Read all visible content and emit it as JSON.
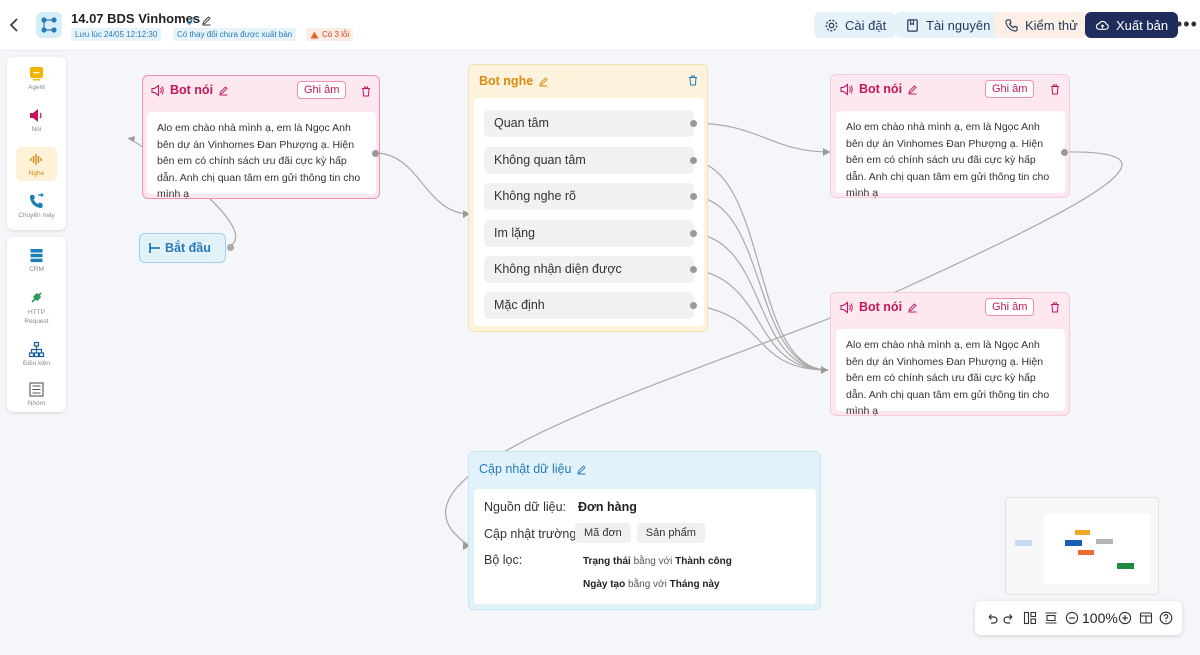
{
  "header": {
    "title": "14.07 BDS Vinhomes",
    "saved_at": "Lưu lúc 24/05 12:12:30",
    "unpublished_notice": "Có thay đổi chưa được xuất bản",
    "error_badge": "Có 3 lỗi",
    "buttons": {
      "settings": "Cài đặt",
      "resources": "Tài nguyên",
      "test": "Kiểm thử",
      "publish": "Xuất bản"
    }
  },
  "palette": {
    "group1": [
      {
        "label": "Agent",
        "icon": "agent-icon"
      },
      {
        "label": "Nói",
        "icon": "speaker-icon"
      },
      {
        "label": "Nghe",
        "icon": "soundwave-icon"
      },
      {
        "label": "Chuyển máy",
        "icon": "phone-transfer-icon"
      }
    ],
    "group2": [
      {
        "label": "CRM",
        "icon": "database-icon"
      },
      {
        "label": "HTTP Request",
        "icon": "plug-icon"
      },
      {
        "label": "Điều kiện",
        "icon": "hierarchy-icon"
      },
      {
        "label": "Nhóm",
        "icon": "group-icon"
      }
    ]
  },
  "nodes": {
    "start": {
      "label": "Bắt đầu"
    },
    "bot_speak_1": {
      "title": "Bot nói",
      "record": "Ghi âm",
      "message": "Alo em chào nhà mình ạ, em là Ngọc Anh bên dự án Vinhomes Đan Phượng ạ. Hiện bên em có chính sách ưu đãi cực kỳ hấp dẫn. Anh chị quan tâm em gửi thông tin cho mình ạ"
    },
    "bot_listen": {
      "title": "Bot nghe",
      "options": [
        "Quan tâm",
        "Không quan tâm",
        "Không nghe rõ",
        "Im lặng",
        "Không nhận diện được",
        "Mặc định"
      ]
    },
    "bot_speak_2": {
      "title": "Bot nói",
      "record": "Ghi âm",
      "message": "Alo em chào nhà mình ạ, em là Ngọc Anh bên dự án Vinhomes Đan Phượng ạ. Hiện bên em có chính sách ưu đãi cực kỳ hấp dẫn. Anh chị quan tâm em gửi thông tin cho mình ạ"
    },
    "bot_speak_3": {
      "title": "Bot nói",
      "record": "Ghi âm",
      "message": "Alo em chào nhà mình ạ, em là Ngọc Anh bên dự án Vinhomes Đan Phượng ạ. Hiện bên em có chính sách ưu đãi cực kỳ hấp dẫn. Anh chị quan tâm em gửi thông tin cho mình ạ"
    },
    "update_data": {
      "title": "Cập nhật dữ liệu",
      "source_label": "Nguồn dữ liệu:",
      "source_value": "Đơn hàng",
      "fields_label": "Cập nhật trường:",
      "fields": [
        "Mã đơn",
        "Sản phẩm"
      ],
      "filter_label": "Bộ lọc:",
      "filters": [
        {
          "field": "Trạng thái",
          "op": "bằng với",
          "value": "Thành công"
        },
        {
          "field": "Ngày tạo",
          "op": "bằng với",
          "value": "Tháng này"
        }
      ]
    }
  },
  "zoom": {
    "level": "100%"
  },
  "colors": {
    "speak_border": "#f48fb1",
    "speak_bg": "#fde8ef",
    "listen_bg": "#fdf3dd",
    "update_bg": "#e1f2fb",
    "start_bg": "#e1f2fb",
    "publish_bg": "#1f2d5c",
    "accent_pink": "#c2185b",
    "accent_orange": "#d98a12",
    "accent_blue": "#2a7ab8"
  }
}
